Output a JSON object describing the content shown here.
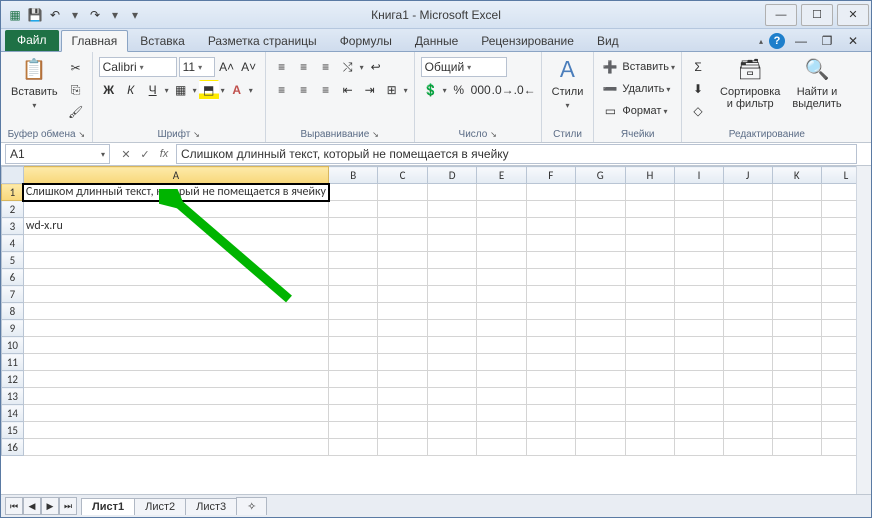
{
  "title": "Книга1 - Microsoft Excel",
  "qat": {
    "save": "💾",
    "undo": "↶",
    "redo": "↷"
  },
  "wincontrols": {
    "min": "—",
    "max": "☐",
    "close": "✕"
  },
  "tabs": {
    "file": "Файл",
    "items": [
      "Главная",
      "Вставка",
      "Разметка страницы",
      "Формулы",
      "Данные",
      "Рецензирование",
      "Вид"
    ],
    "active_index": 0
  },
  "ribbon": {
    "clipboard": {
      "label": "Буфер обмена",
      "paste": "Вставить"
    },
    "font": {
      "label": "Шрифт",
      "name": "Calibri",
      "size": "11"
    },
    "align": {
      "label": "Выравнивание"
    },
    "number": {
      "label": "Число",
      "format": "Общий"
    },
    "styles": {
      "label": "Стили",
      "btn": "Стили"
    },
    "cells": {
      "label": "Ячейки",
      "insert": "Вставить",
      "delete": "Удалить",
      "format": "Формат"
    },
    "editing": {
      "label": "Редактирование",
      "sort": "Сортировка\nи фильтр",
      "find": "Найти и\nвыделить"
    }
  },
  "namebox": "A1",
  "fx_label": "fx",
  "formula": "Слишком длинный текст, который не помещается в ячейку",
  "columns": [
    "A",
    "B",
    "C",
    "D",
    "E",
    "F",
    "G",
    "H",
    "I",
    "J",
    "K",
    "L"
  ],
  "rows_count": 16,
  "cells": {
    "A1": "Слишком длинный текст, который не помещается в ячейку",
    "A3": "wd-x.ru"
  },
  "sheets": {
    "items": [
      "Лист1",
      "Лист2",
      "Лист3"
    ],
    "active_index": 0,
    "add": "✧"
  },
  "icons": {
    "dd": "▾",
    "launcher": "↘",
    "min2": "—",
    "restore": "❐",
    "close2": "✕",
    "expand": "▴"
  }
}
